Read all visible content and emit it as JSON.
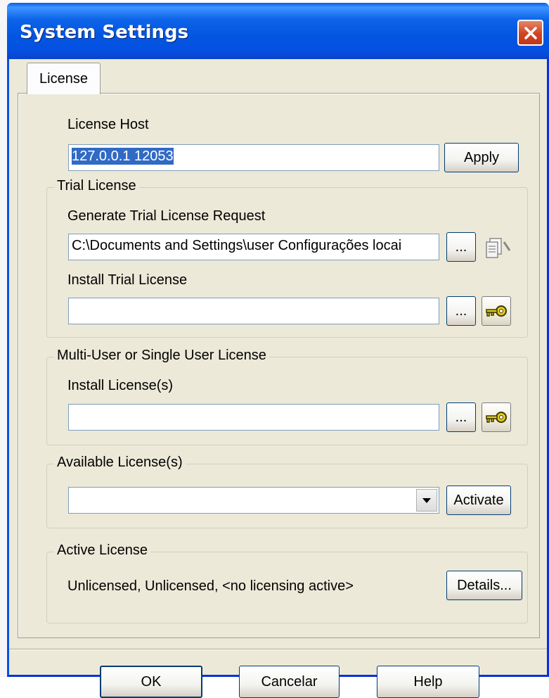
{
  "window": {
    "title": "System Settings"
  },
  "tabs": [
    {
      "label": "License"
    }
  ],
  "license_host": {
    "label": "License Host",
    "value": "127.0.0.1 12053",
    "apply_label": "Apply"
  },
  "trial_license": {
    "group_title": "Trial License",
    "generate_label": "Generate Trial License Request",
    "generate_path": "C:\\Documents and Settings\\user  Configurações locai",
    "browse_label": "...",
    "install_label": "Install Trial License",
    "install_value": "",
    "install_browse_label": "..."
  },
  "multi_user": {
    "group_title": "Multi-User or Single User License",
    "install_label": "Install License(s)",
    "install_value": "",
    "browse_label": "..."
  },
  "available": {
    "group_title": "Available License(s)",
    "selected": "",
    "activate_label": "Activate"
  },
  "active": {
    "group_title": "Active License",
    "status_text": "Unlicensed,  Unlicensed,  <no licensing active>",
    "details_label": "Details..."
  },
  "footer": {
    "ok_label": "OK",
    "cancel_label": "Cancelar",
    "help_label": "Help"
  },
  "icons": {
    "close": "close-icon",
    "generate": "document-request-icon",
    "install_key": "key-icon",
    "dropdown": "chevron-down-icon"
  },
  "colors": {
    "titlebar": "#0355e0",
    "dialog_bg": "#ece9d8",
    "selection": "#316ac5",
    "close_button": "#cf4322"
  }
}
